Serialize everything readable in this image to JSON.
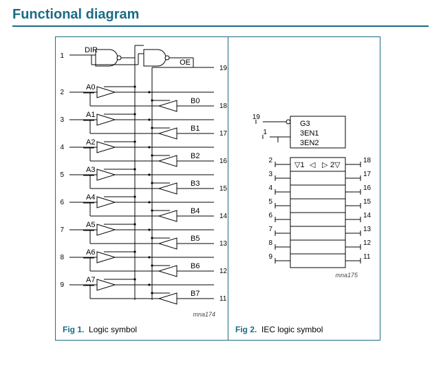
{
  "title": "Functional diagram",
  "fig1": {
    "caption_label": "Fig 1.",
    "caption_text": "Logic symbol",
    "dir": "DIR",
    "oe": "OE",
    "pins_dir": "1",
    "pins_oe": "19",
    "channels": [
      {
        "a_pin": "2",
        "a_sig": "A0",
        "b_sig": "B0",
        "b_pin": "18"
      },
      {
        "a_pin": "3",
        "a_sig": "A1",
        "b_sig": "B1",
        "b_pin": "17"
      },
      {
        "a_pin": "4",
        "a_sig": "A2",
        "b_sig": "B2",
        "b_pin": "16"
      },
      {
        "a_pin": "5",
        "a_sig": "A3",
        "b_sig": "B3",
        "b_pin": "15"
      },
      {
        "a_pin": "6",
        "a_sig": "A4",
        "b_sig": "B4",
        "b_pin": "14"
      },
      {
        "a_pin": "7",
        "a_sig": "A5",
        "b_sig": "B5",
        "b_pin": "13"
      },
      {
        "a_pin": "8",
        "a_sig": "A6",
        "b_sig": "B6",
        "b_pin": "12"
      },
      {
        "a_pin": "9",
        "a_sig": "A7",
        "b_sig": "B7",
        "b_pin": "11"
      }
    ],
    "id": "mna174"
  },
  "fig2": {
    "caption_label": "Fig 2.",
    "caption_text": "IEC logic symbol",
    "top_pin_oe": "19",
    "top_pin_dir": "1",
    "g3": "G3",
    "en1": "3EN1",
    "en2": "3EN2",
    "row_marker_left": "▽1",
    "row_marker_left2": "◁",
    "row_marker_right": "▷",
    "row_marker_right2": "2▽",
    "left_pins": [
      "2",
      "3",
      "4",
      "5",
      "6",
      "7",
      "8",
      "9"
    ],
    "right_pins": [
      "18",
      "17",
      "16",
      "15",
      "14",
      "13",
      "12",
      "11"
    ],
    "id": "mna175"
  }
}
